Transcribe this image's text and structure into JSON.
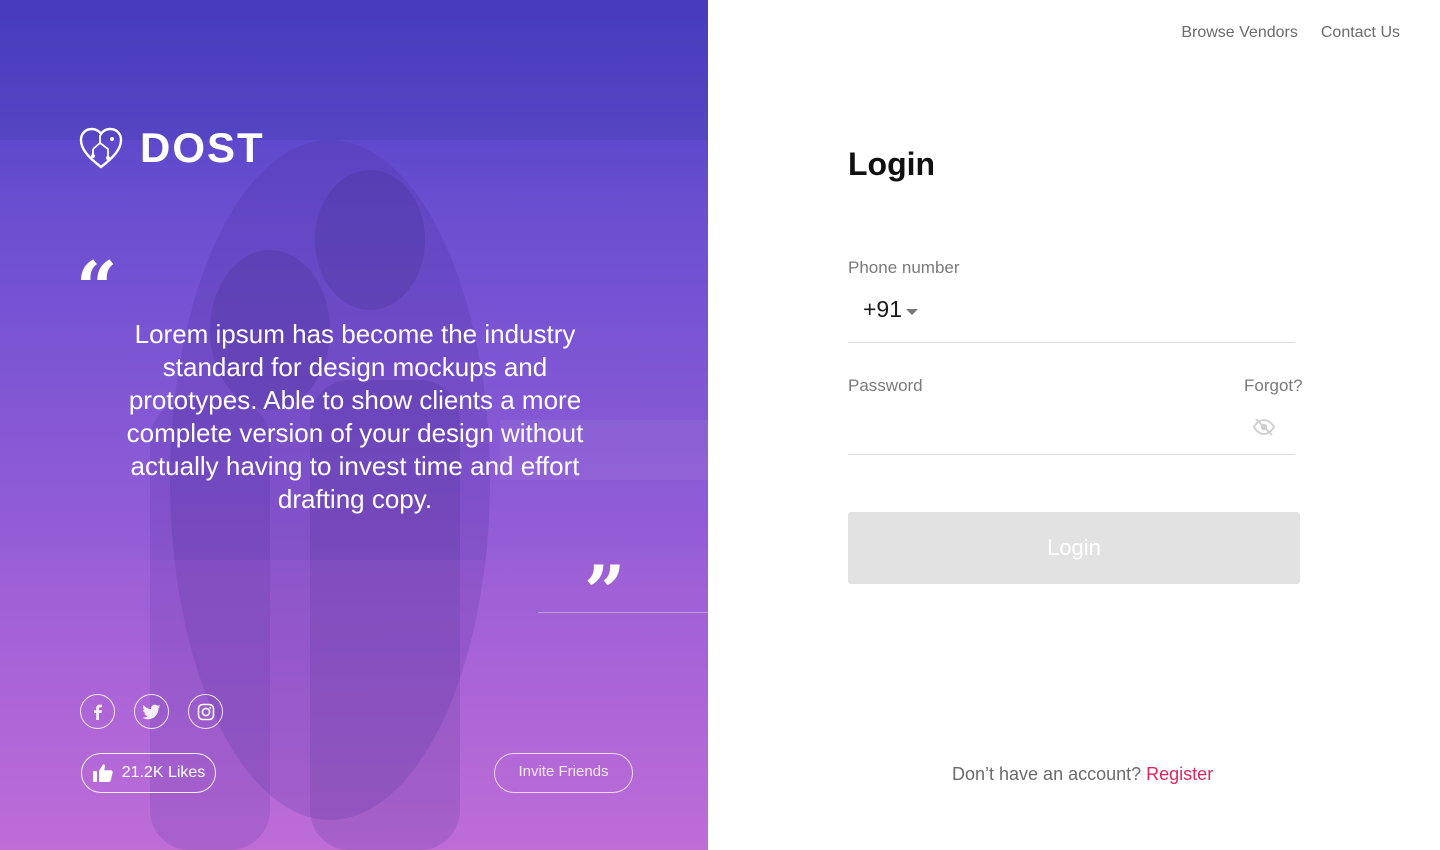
{
  "brand": {
    "name": "DOST",
    "logo_icon": "heart-circuit-icon"
  },
  "hero": {
    "open_quote": "“",
    "close_quote": "”",
    "quote": "Lorem ipsum has become the industry standard for design mockups and prototypes. Able to show clients a more complete version of your design without actually having to invest time and effort drafting copy."
  },
  "socials": [
    {
      "name": "facebook-icon"
    },
    {
      "name": "twitter-icon"
    },
    {
      "name": "instagram-icon"
    }
  ],
  "likes": {
    "label": "21.2K Likes",
    "icon": "thumbs-up-icon"
  },
  "invite": {
    "label": "Invite Friends"
  },
  "nav": {
    "browse": "Browse Vendors",
    "contact": "Contact Us"
  },
  "login": {
    "title": "Login",
    "phone_label": "Phone number",
    "country_code": "+91",
    "phone_value": "",
    "password_label": "Password",
    "password_value": "",
    "forgot": "Forgot?",
    "button": "Login",
    "no_account": "Don’t have an account?",
    "register": "Register"
  },
  "colors": {
    "gradient_top": "#4a3cc4",
    "gradient_bottom": "#bd6ed8",
    "register_link": "#e0245e",
    "button_disabled": "#e2e2e2"
  }
}
